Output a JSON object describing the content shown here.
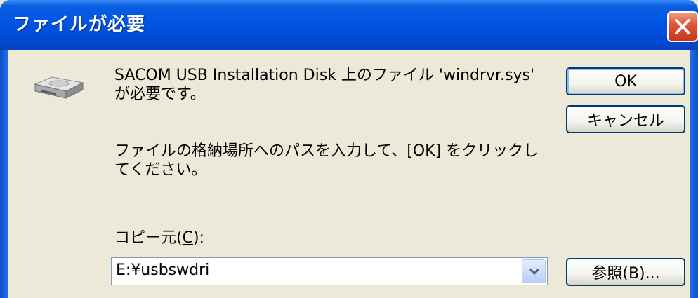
{
  "window": {
    "title": "ファイルが必要"
  },
  "message": {
    "line1": "SACOM USB Installation Disk 上のファイル 'windrvr.sys' が必要です。",
    "line2": "ファイルの格納場所へのパスを入力して、[OK] をクリックしてください。"
  },
  "buttons": {
    "ok": "OK",
    "cancel": "キャンセル",
    "browse": "参照(B)..."
  },
  "copy_from": {
    "label_prefix": "コピー元(",
    "label_mnemonic": "C",
    "label_suffix": "):",
    "value": "E:¥usbswdri"
  },
  "icons": {
    "close": "close-icon",
    "disk": "disk-drive-icon",
    "dropdown": "chevron-down-icon"
  },
  "colors": {
    "titlebar": "#0055e5",
    "close_button": "#e0573a",
    "dialog_background": "#ece9d8",
    "button_border": "#003c74"
  }
}
